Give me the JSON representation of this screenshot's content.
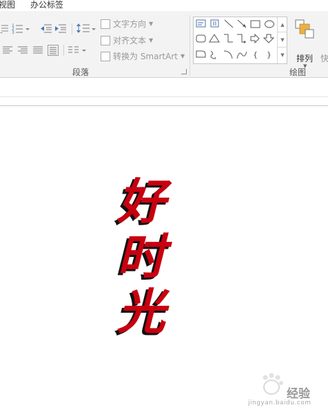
{
  "tabs": {
    "view": "视图",
    "office_tags": "办公标签"
  },
  "paragraph_group": {
    "label": "段落",
    "text_direction": "文字方向",
    "align_text": "对齐文本",
    "convert_smartart": "转换为 SmartArt"
  },
  "drawing_group": {
    "label": "绘图",
    "arrange": "排列",
    "quick_styles_partial": "快"
  },
  "slide": {
    "art_text": "好时光",
    "art_color": "#c8000f",
    "art_shadow_color": "#111111"
  },
  "watermark": {
    "brand": "经验",
    "url": "jingyan.baidu.com"
  }
}
